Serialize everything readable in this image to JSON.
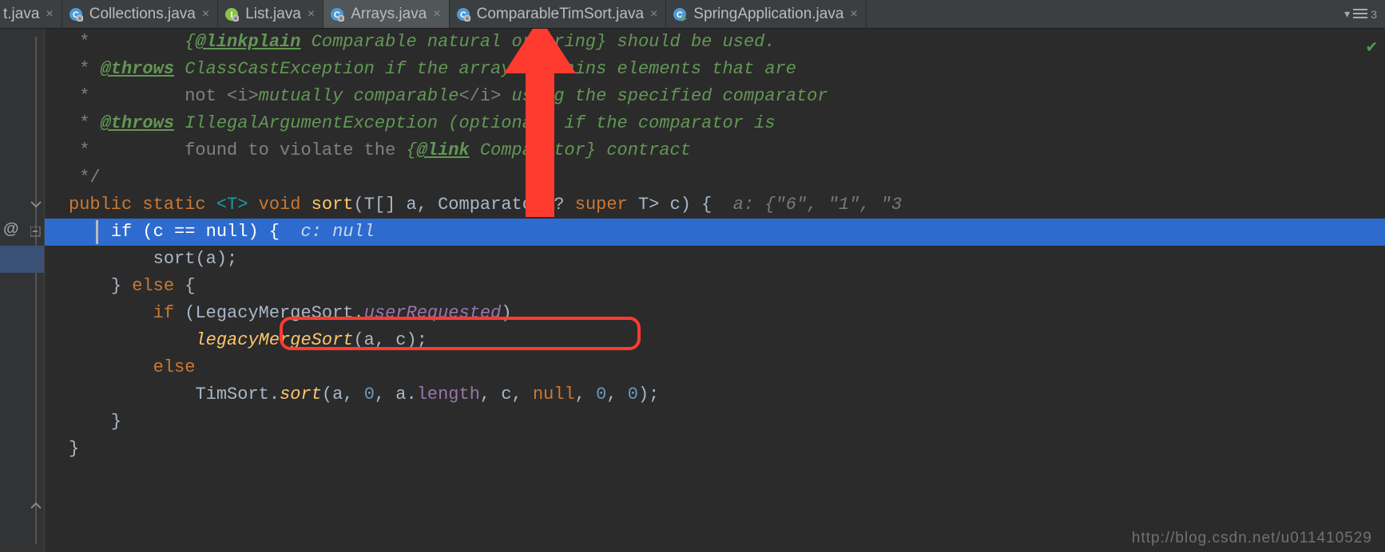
{
  "tabs": [
    {
      "label": "t.java",
      "iconColor": "#4e9ad6",
      "active": false,
      "partial": true
    },
    {
      "label": "Collections.java",
      "iconColor": "#4e9ad6",
      "active": false
    },
    {
      "label": "List.java",
      "iconColor": "#8bc34a",
      "active": false,
      "iconLetter": "I"
    },
    {
      "label": "Arrays.java",
      "iconColor": "#4e9ad6",
      "active": true
    },
    {
      "label": "ComparableTimSort.java",
      "iconColor": "#4e9ad6",
      "active": false
    },
    {
      "label": "SpringApplication.java",
      "iconColor": "#4e9ad6",
      "active": false,
      "runnable": true
    }
  ],
  "split_count": "3",
  "gutter": {
    "override_marker": "@"
  },
  "code": {
    "l1_star": " *         ",
    "l1_linkplain_open": "{",
    "l1_linkplain": "@linkplain",
    "l1_rest": " Comparable natural ordering} should be used.",
    "l2_star": " * ",
    "l2_throws": "@throws",
    "l2_rest": " ClassCastException if the array contains elements that are",
    "l3_star": " *         not ",
    "l3_i_open": "<i>",
    "l3_mid": "mutually comparable",
    "l3_i_close": "</i>",
    "l3_rest": " using the specified comparator",
    "l4_star": " * ",
    "l4_throws": "@throws",
    "l4_rest": " IllegalArgumentException (optional) if the comparator is",
    "l5_star": " *         found to violate the ",
    "l5_link_open": "{",
    "l5_link": "@link",
    "l5_rest": " Comparator} contract",
    "l6_close": " */",
    "sig_public": "public",
    "sig_static": "static",
    "sig_typep": "<T>",
    "sig_void": "void",
    "sig_name": "sort",
    "sig_args_open": "(",
    "sig_arg1_t": "T[] ",
    "sig_arg1_n": "a",
    "sig_sep": ", ",
    "sig_arg2_t": "Comparator<? ",
    "sig_super": "super",
    "sig_arg2_t2": " T> ",
    "sig_arg2_n": "c",
    "sig_args_close": ") {",
    "sig_hint": "a: {\"6\", \"1\", \"3",
    "if1_if": "if",
    "if1_open": " (",
    "if1_c": "c",
    "if1_eq": " == ",
    "if1_null": "null",
    "if1_close": ") {",
    "if1_hint": "c: null",
    "sorta_call": "sort",
    "sorta_args": "(a);",
    "else_close": "} ",
    "else_kw": "else",
    "else_open": " {",
    "if2_if": "if",
    "if2_open": " (",
    "if2_cls": "LegacyMergeSort",
    "if2_dot": ".",
    "if2_field": "userRequested",
    "if2_close": ")",
    "lms_call": "legacyMergeSort",
    "lms_args": "(a, c);",
    "else2": "else",
    "tim_cls": "TimSort",
    "tim_dot": ".",
    "tim_sort": "sort",
    "tim_open": "(a, ",
    "tim_z1": "0",
    "tim_s1": ", a.",
    "tim_len": "length",
    "tim_s2": ", c, ",
    "tim_null": "null",
    "tim_s3": ", ",
    "tim_z2": "0",
    "tim_s4": ", ",
    "tim_z3": "0",
    "tim_close": ");",
    "brace_inner": "}",
    "brace_outer": "}"
  },
  "watermark": "http://blog.csdn.net/u011410529"
}
